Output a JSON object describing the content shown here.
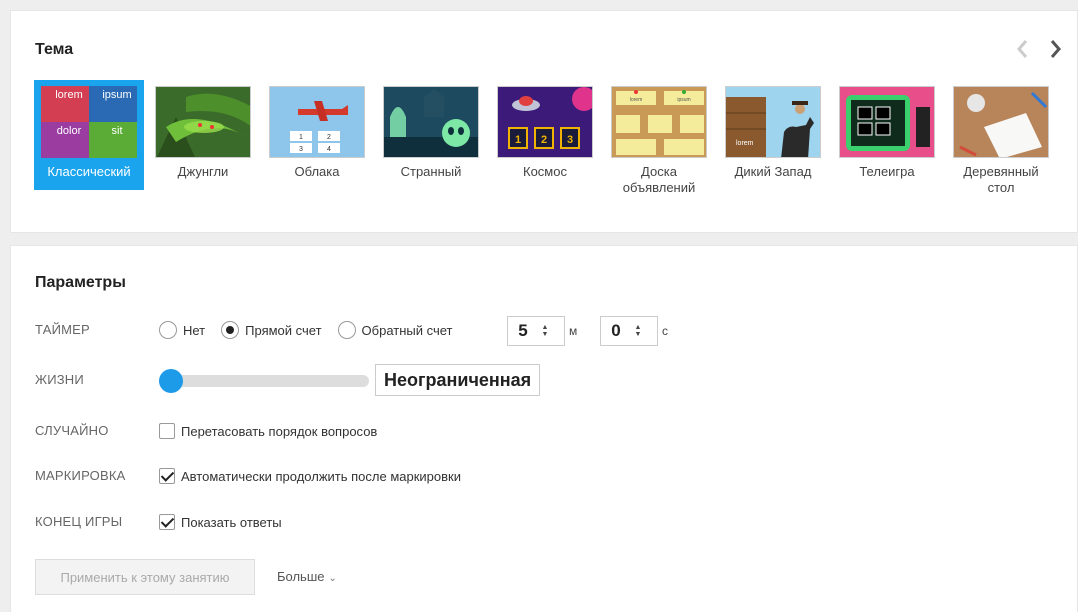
{
  "theme_section": {
    "title": "Тема",
    "themes": [
      {
        "name": "Классический",
        "selected": true,
        "tiles": [
          "lorem",
          "ipsum",
          "dolor",
          "sit"
        ]
      },
      {
        "name": "Джунгли",
        "selected": false
      },
      {
        "name": "Облака",
        "selected": false,
        "tiles": [
          "1",
          "2",
          "3",
          "4"
        ]
      },
      {
        "name": "Странный",
        "selected": false
      },
      {
        "name": "Космос",
        "selected": false,
        "tiles": [
          "1",
          "2",
          "3"
        ]
      },
      {
        "name": "Доска объявлений",
        "selected": false,
        "tiles": [
          "lorem",
          "ipsum"
        ]
      },
      {
        "name": "Дикий Запад",
        "selected": false,
        "tiles": [
          "lorem"
        ]
      },
      {
        "name": "Телеигра",
        "selected": false
      },
      {
        "name": "Деревянный стол",
        "selected": false
      }
    ]
  },
  "params": {
    "title": "Параметры",
    "timer": {
      "label": "ТАЙМЕР",
      "options": [
        "Нет",
        "Прямой счет",
        "Обратный счет"
      ],
      "selected": "Прямой счет",
      "minutes": "5",
      "minutes_unit": "м",
      "seconds": "0",
      "seconds_unit": "с"
    },
    "lives": {
      "label": "ЖИЗНИ",
      "value": "Неограниченная",
      "slider_position": 0
    },
    "random": {
      "label": "СЛУЧАЙНО",
      "option": "Перетасовать порядок вопросов",
      "checked": false
    },
    "marking": {
      "label": "МАРКИРОВКА",
      "option": "Автоматически продолжить после маркировки",
      "checked": true
    },
    "end_game": {
      "label": "КОНЕЦ ИГРЫ",
      "option": "Показать ответы",
      "checked": true
    },
    "apply_button": "Применить к этому занятию",
    "more_link": "Больше"
  },
  "colors": {
    "accent": "#1aa4ee",
    "slider": "#1e9be8",
    "background": "#eeeeee"
  }
}
